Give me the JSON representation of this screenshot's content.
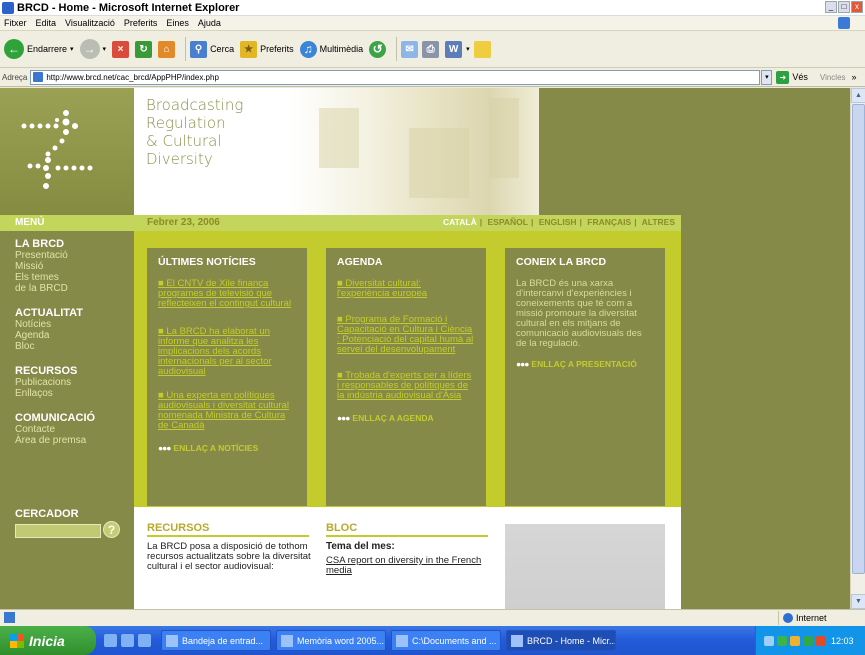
{
  "window": {
    "title": "BRCD - Home - Microsoft Internet Explorer",
    "controls": [
      "_",
      "□",
      "x"
    ]
  },
  "menubar": [
    "Fitxer",
    "Edita",
    "Visualització",
    "Preferits",
    "Eines",
    "Ajuda"
  ],
  "toolbar": {
    "back_label": "Endarrere",
    "search_label": "Cerca",
    "favorites_label": "Preferits",
    "media_label": "Multimèdia"
  },
  "address": {
    "label": "Adreça",
    "url": "http://www.brcd.net/cac_brcd/AppPHP/index.php",
    "go_label": "Vés",
    "links_label": "Vincles"
  },
  "site": {
    "brand_lines": [
      "Broadcasting",
      "Regulation",
      "& Cultural",
      "Diversity"
    ],
    "menu_heading": "MENÚ",
    "date": "Febrer 23, 2006",
    "languages": [
      "CATALÀ",
      "ESPAÑOL",
      "ENGLISH",
      "FRANÇAIS",
      "ALTRES"
    ],
    "active_language": "CATALÀ",
    "nav": [
      {
        "section": "LA BRCD",
        "items": [
          "Presentació",
          "Missió",
          "Els temes",
          "de la BRCD"
        ]
      },
      {
        "section": "ACTUALITAT",
        "items": [
          "Notícies",
          "Agenda",
          "Bloc"
        ]
      },
      {
        "section": "RECURSOS",
        "items": [
          "Publicacions",
          "Enllaços"
        ]
      },
      {
        "section": "COMUNICACIÓ",
        "items": [
          "Contacte",
          "Àrea de premsa"
        ]
      }
    ],
    "search_heading": "CERCADOR",
    "search_button": "?",
    "columns": {
      "news": {
        "title": "ÚLTIMES NOTÍCIES",
        "links": [
          "■ El CNTV de Xile finança programes de televisió que reflecteixen el contingut cultural",
          "■ La BRCD ha elaborat un informe que analitza les implicacions dels acords internacionals per al sector audiovisual",
          "■ Una experta en polítiques audiovisuals i diversitat cultural nomenada Ministra de Cultura de Canadà"
        ],
        "more": "ENLLAÇ A NOTÍCIES"
      },
      "agenda": {
        "title": "AGENDA",
        "links": [
          "■ Diversitat cultural: l'experiència europea",
          "■ Programa de Formació i Capacitació en Cultura i Ciència : Potenciació del capital humà al servei del desenvolupament",
          "■ Trobada d'experts per a líders i responsables de polítiques de la indústria audiovisual d'Àsia"
        ],
        "more": "ENLLAÇ A AGENDA"
      },
      "about": {
        "title": "CONEIX LA BRCD",
        "text": "La BRCD és una xarxa d'intercanvi d'experiències i coneixements que té com a missió promoure la diversitat cultural en els mitjans de comunicació audiovisuals des de la regulació.",
        "more": "ENLLAÇ A PRESENTACIÓ"
      }
    },
    "resources": {
      "heading": "RECURSOS",
      "text": "La BRCD posa a disposició de tothom recursos actualitzats sobre la diversitat cultural i el sector audiovisual:"
    },
    "blog": {
      "heading": "BLOC",
      "theme_label": "Tema del mes:",
      "link": "CSA report on diversity in the French media"
    }
  },
  "statusbar": {
    "zone": "Internet"
  },
  "taskbar": {
    "start": "Inicia",
    "tasks": [
      "Bandeja de entrad...",
      "Memòria word 2005...",
      "C:\\Documents and ...",
      "BRCD - Home - Micr..."
    ],
    "clock": "12:03"
  },
  "colors": {
    "olive": "#868a48",
    "lime": "#c3d55a",
    "yellow_green": "#c3cc2c"
  }
}
